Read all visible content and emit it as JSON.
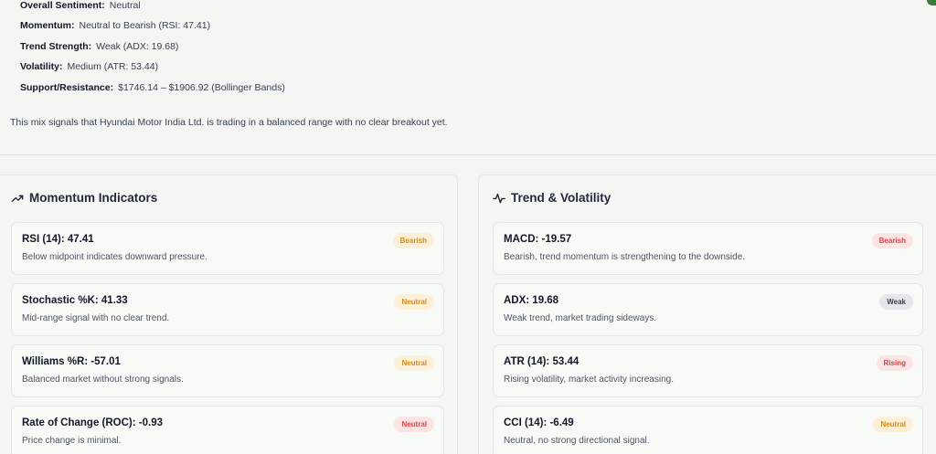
{
  "summary": {
    "rows": [
      {
        "label": "Overall Sentiment:",
        "value": "Neutral"
      },
      {
        "label": "Momentum:",
        "value": "Neutral to Bearish (RSI: 47.41)"
      },
      {
        "label": "Trend Strength:",
        "value": "Weak (ADX: 19.68)"
      },
      {
        "label": "Volatility:",
        "value": "Medium (ATR: 53.44)"
      },
      {
        "label": "Support/Resistance:",
        "value": "$1746.14 – $1906.92 (Bollinger Bands)"
      }
    ],
    "note": "This mix signals that Hyundai Motor India Ltd. is trading in a balanced range with no clear breakout yet."
  },
  "momentum": {
    "title": "Momentum Indicators",
    "icon": "trending-up-icon",
    "cards": [
      {
        "title": "RSI (14): 47.41",
        "desc": "Below midpoint indicates downward pressure.",
        "badge": "Bearish",
        "badge_type": "neutral"
      },
      {
        "title": "Stochastic %K: 41.33",
        "desc": "Mid-range signal with no clear trend.",
        "badge": "Neutral",
        "badge_type": "neutral"
      },
      {
        "title": "Williams %R: -57.01",
        "desc": "Balanced market without strong signals.",
        "badge": "Neutral",
        "badge_type": "neutral"
      },
      {
        "title": "Rate of Change (ROC): -0.93",
        "desc": "Price change is minimal.",
        "badge": "Neutral",
        "badge_type": "bearish"
      }
    ]
  },
  "trend": {
    "title": "Trend & Volatility",
    "icon": "activity-icon",
    "cards": [
      {
        "title": "MACD: -19.57",
        "desc": "Bearish, trend momentum is strengthening to the downside.",
        "badge": "Bearish",
        "badge_type": "bearish"
      },
      {
        "title": "ADX: 19.68",
        "desc": "Weak trend, market trading sideways.",
        "badge": "Weak",
        "badge_type": "weak"
      },
      {
        "title": "ATR (14): 53.44",
        "desc": "Rising volatility, market activity increasing.",
        "badge": "Rising",
        "badge_type": "rising"
      },
      {
        "title": "CCI (14): -6.49",
        "desc": "Neutral, no strong directional signal.",
        "badge": "Neutral",
        "badge_type": "neutral"
      }
    ]
  },
  "colors": {
    "background": "#f3f6f2",
    "bearish": "#d64545",
    "neutral": "#d18a1f",
    "accent": "#3d7a3d"
  }
}
